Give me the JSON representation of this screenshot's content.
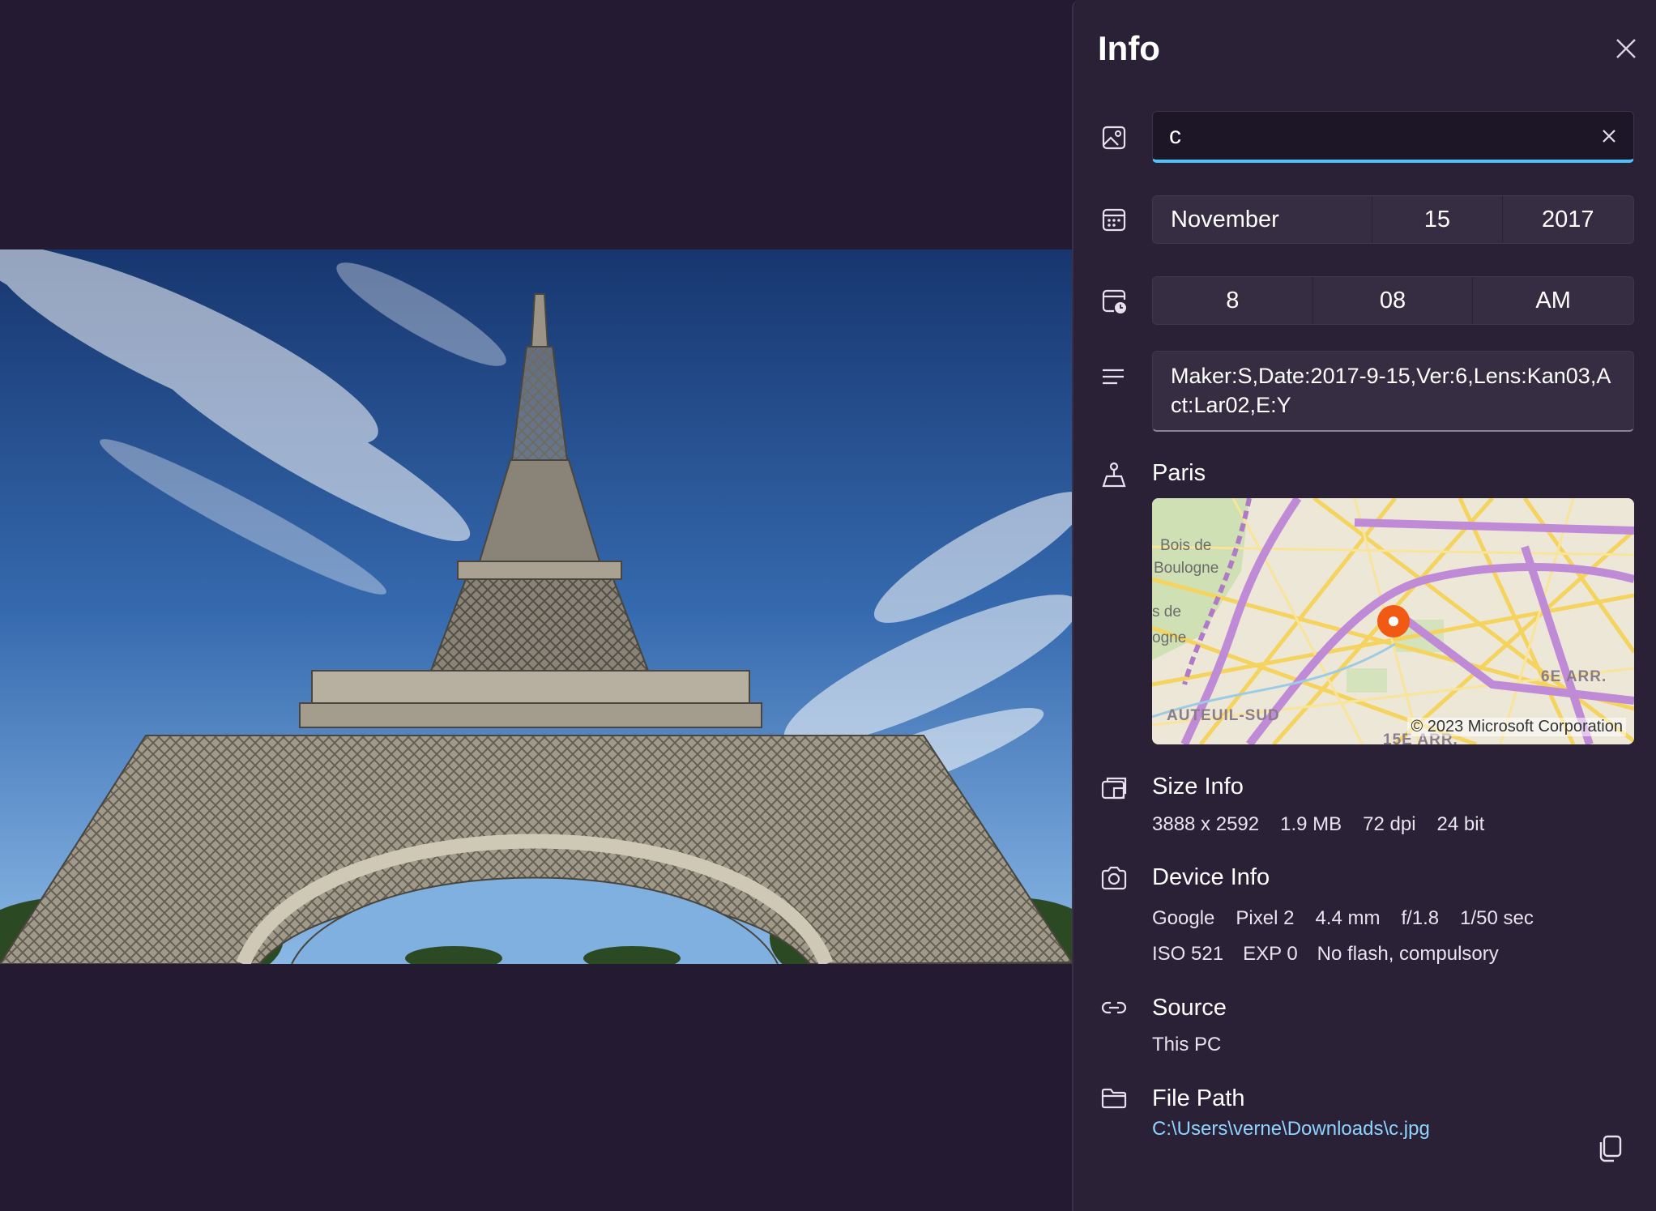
{
  "panel": {
    "title": "Info",
    "close_icon": "close-icon"
  },
  "name_field": {
    "value": "c",
    "icon": "image-icon",
    "clear_icon": "clear-icon"
  },
  "date": {
    "icon": "calendar-icon",
    "month": "November",
    "day": "15",
    "year": "2017"
  },
  "time": {
    "icon": "clock-icon",
    "hour": "8",
    "minute": "08",
    "period": "AM"
  },
  "description": {
    "icon": "text-lines-icon",
    "text": "Maker:S,Date:2017-9-15,Ver:6,Lens:Kan03,Act:Lar02,E:Y"
  },
  "location": {
    "icon": "location-pin-icon",
    "label": "Paris",
    "map": {
      "labels": [
        "Bois de",
        "Boulogne",
        "s de",
        "ogne",
        "6E ARR.",
        "AUTEUIL-SUD",
        "15E ARR."
      ],
      "copyright": "© 2023 Microsoft Corporation",
      "pin_color": "#f15a13"
    }
  },
  "size_info": {
    "icon": "image-size-icon",
    "label": "Size Info",
    "values": [
      "3888 x 2592",
      "1.9 MB",
      "72 dpi",
      "24 bit"
    ]
  },
  "device_info": {
    "icon": "camera-icon",
    "label": "Device Info",
    "line1": [
      "Google",
      "Pixel 2",
      "4.4 mm",
      "f/1.8",
      "1/50 sec"
    ],
    "line2": [
      "ISO 521",
      "EXP 0",
      "No flash, compulsory"
    ]
  },
  "source": {
    "icon": "link-icon",
    "label": "Source",
    "value": "This PC"
  },
  "file_path": {
    "icon": "folder-icon",
    "label": "File Path",
    "value": "C:\\Users\\verne\\Downloads\\c.jpg",
    "copy_icon": "copy-icon"
  },
  "colors": {
    "background": "#241a32",
    "panel": "#2a2137",
    "accent": "#4cc2ff",
    "link": "#8fd3ff"
  }
}
